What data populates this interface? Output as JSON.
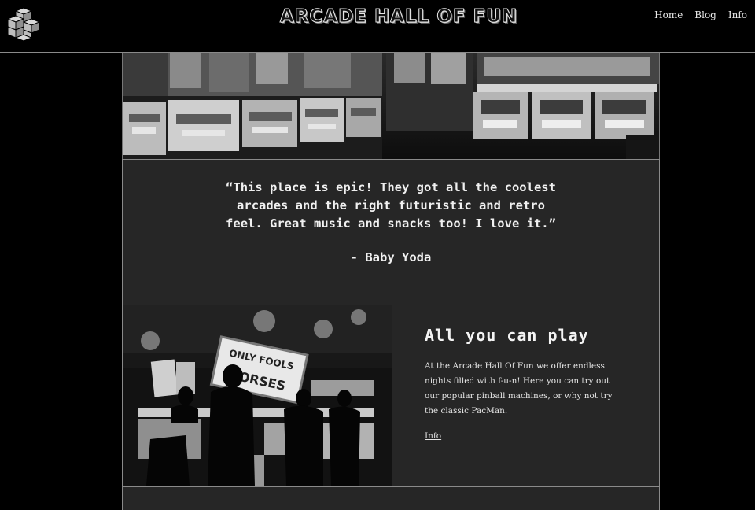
{
  "header": {
    "title": "ARCADE HALL OF FUN",
    "nav": [
      {
        "label": "Home"
      },
      {
        "label": "Blog"
      },
      {
        "label": "Info"
      }
    ]
  },
  "testimonial": {
    "quote": "“This place is epic! They got all the coolest arcades and the right futuristic and retro feel. Great music and snacks too! I love it.”",
    "author": "- Baby Yoda"
  },
  "feature": {
    "heading": "All you can play",
    "body": "At the Arcade Hall Of Fun we offer endless nights filled with f-u-n! Here you can try out our popular pinball machines, or why not try the classic PacMan.",
    "link_label": "Info",
    "sign_text": [
      "ONLY FOOLS",
      "HORSES"
    ]
  },
  "colors": {
    "background": "#000000",
    "panel": "#262626",
    "border": "#8a8a8a",
    "text": "#e8e8e8"
  }
}
